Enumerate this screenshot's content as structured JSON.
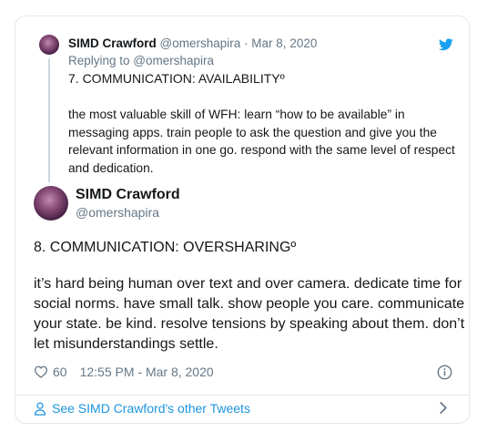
{
  "parent_tweet": {
    "name": "SIMD Crawford",
    "handle": "@omershapira",
    "date": "Mar 8, 2020",
    "replying_to": "Replying to @omershapira",
    "line1": "7. COMMUNICATION: AVAILABILITYº",
    "paragraph": "the most valuable skill of WFH: learn “how to be available” in messaging apps. train people to ask the question and give you the relevant information in one go. respond with the same level of respect and dedication."
  },
  "main_tweet": {
    "name": "SIMD Crawford",
    "handle": "@omershapira",
    "line1": "8. COMMUNICATION: OVERSHARINGº",
    "paragraph": "it’s hard being human over text and over camera. dedicate time for social norms. have small talk. show people you care. communicate your state. be kind. resolve tensions by speaking about them. don’t let misunderstandings settle.",
    "likes": "60",
    "timestamp": "12:55 PM - Mar 8, 2020"
  },
  "footer": {
    "link_text": "See SIMD Crawford's other Tweets"
  },
  "icons": {
    "brand": "twitter-bird-icon",
    "like": "heart-icon",
    "info": "info-icon",
    "profile": "person-icon",
    "chevron": "chevron-right-icon"
  },
  "colors": {
    "accent": "#1b95e0",
    "bird": "#1da1f2",
    "secondary_text": "#657786",
    "border": "#e1e8ed"
  }
}
